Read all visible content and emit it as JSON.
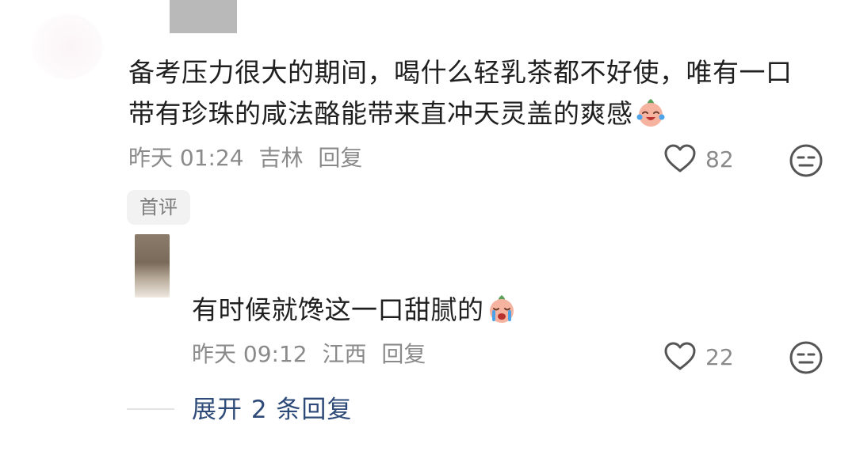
{
  "comment": {
    "text_line1": "备考压力很大的期间，喝什么轻乳茶都不好使，唯有一口",
    "text_line2": "带有珍珠的咸法酪能带来直冲天灵盖的爽感",
    "time": "昨天 01:24",
    "location": "吉林",
    "reply_label": "回复",
    "like_count": "82",
    "badge": "首评",
    "emoji": "laughing-crying-peach-emoji"
  },
  "reply": {
    "text": "有时候就馋这一口甜腻的",
    "time": "昨天 09:12",
    "location": "江西",
    "reply_label": "回复",
    "like_count": "22",
    "emoji": "crying-peach-emoji"
  },
  "expand": {
    "label": "展开 2 条回复"
  },
  "colors": {
    "meta_gray": "#8a8a8a",
    "link_blue": "#2d4a78",
    "badge_bg": "#f2f2f2"
  }
}
